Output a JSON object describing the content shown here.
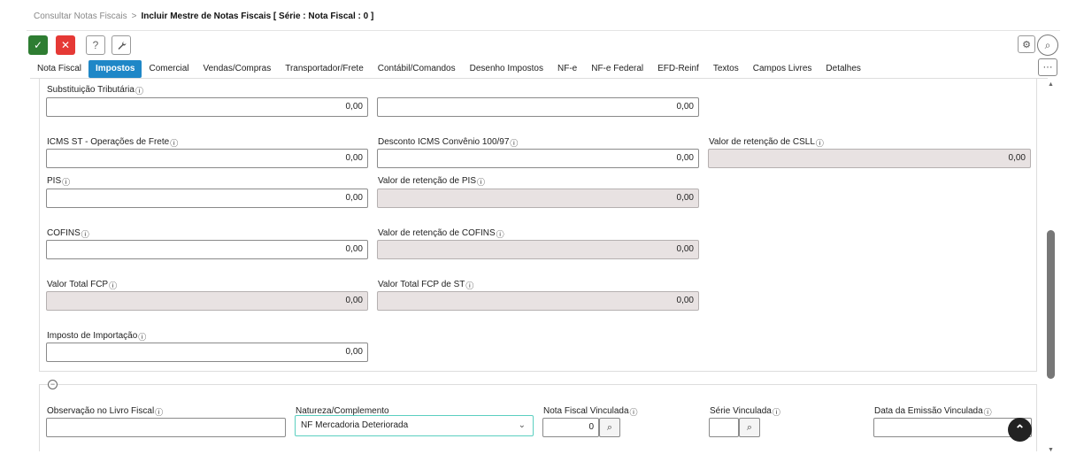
{
  "breadcrumb": {
    "parent": "Consultar Notas Fiscais",
    "separator": ">",
    "current": "Incluir Mestre de Notas Fiscais [ Série : Nota Fiscal : 0 ]"
  },
  "toolbar": {
    "confirm_icon": "✓",
    "cancel_icon": "✕",
    "help_icon": "?",
    "tool_icon": "🔧",
    "settings_icon": "⚙",
    "search_icon": "⌕",
    "more_icon": "···"
  },
  "tabs": [
    {
      "label": "Nota Fiscal",
      "active": false
    },
    {
      "label": "Impostos",
      "active": true
    },
    {
      "label": "Comercial",
      "active": false
    },
    {
      "label": "Vendas/Compras",
      "active": false
    },
    {
      "label": "Transportador/Frete",
      "active": false
    },
    {
      "label": "Contábil/Comandos",
      "active": false
    },
    {
      "label": "Desenho Impostos",
      "active": false
    },
    {
      "label": "NF-e",
      "active": false
    },
    {
      "label": "NF-e Federal",
      "active": false
    },
    {
      "label": "EFD-Reinf",
      "active": false
    },
    {
      "label": "Textos",
      "active": false
    },
    {
      "label": "Campos Livres",
      "active": false
    },
    {
      "label": "Detalhes",
      "active": false
    }
  ],
  "info_icon": "ⓘ",
  "fields": {
    "substituicao_tributaria": {
      "label": "Substituição Tributária",
      "value": "0,00"
    },
    "substituicao_tributaria_2": {
      "value": "0,00"
    },
    "icms_st_frete": {
      "label": "ICMS ST - Operações de Frete",
      "value": "0,00"
    },
    "desconto_icms": {
      "label": "Desconto ICMS Convênio 100/97",
      "value": "0,00"
    },
    "retencao_csll": {
      "label": "Valor de retenção de CSLL",
      "value": "0,00"
    },
    "pis": {
      "label": "PIS",
      "value": "0,00"
    },
    "retencao_pis": {
      "label": "Valor de retenção de PIS",
      "value": "0,00"
    },
    "cofins": {
      "label": "COFINS",
      "value": "0,00"
    },
    "retencao_cofins": {
      "label": "Valor de retenção de COFINS",
      "value": "0,00"
    },
    "total_fcp": {
      "label": "Valor Total FCP",
      "value": "0,00"
    },
    "total_fcp_st": {
      "label": "Valor Total FCP de ST",
      "value": "0,00"
    },
    "imposto_importacao": {
      "label": "Imposto de Importação",
      "value": "0,00"
    }
  },
  "section2": {
    "collapse_icon": "−",
    "observacao": {
      "label": "Observação no Livro Fiscal",
      "value": ""
    },
    "natureza": {
      "label": "Natureza/Complemento",
      "value": "NF Mercadoria Deteriorada",
      "chevron": "⌄"
    },
    "nota_vinculada": {
      "label": "Nota Fiscal Vinculada",
      "value": "0"
    },
    "serie_vinculada": {
      "label": "Série Vinculada",
      "value": ""
    },
    "data_emissao": {
      "label": "Data da Emissão Vinculada",
      "value": ""
    },
    "search_icon": "⌕"
  },
  "scroll": {
    "up": "▲",
    "down": "▼",
    "position": 0.55
  },
  "fab": {
    "icon": "⌃"
  }
}
